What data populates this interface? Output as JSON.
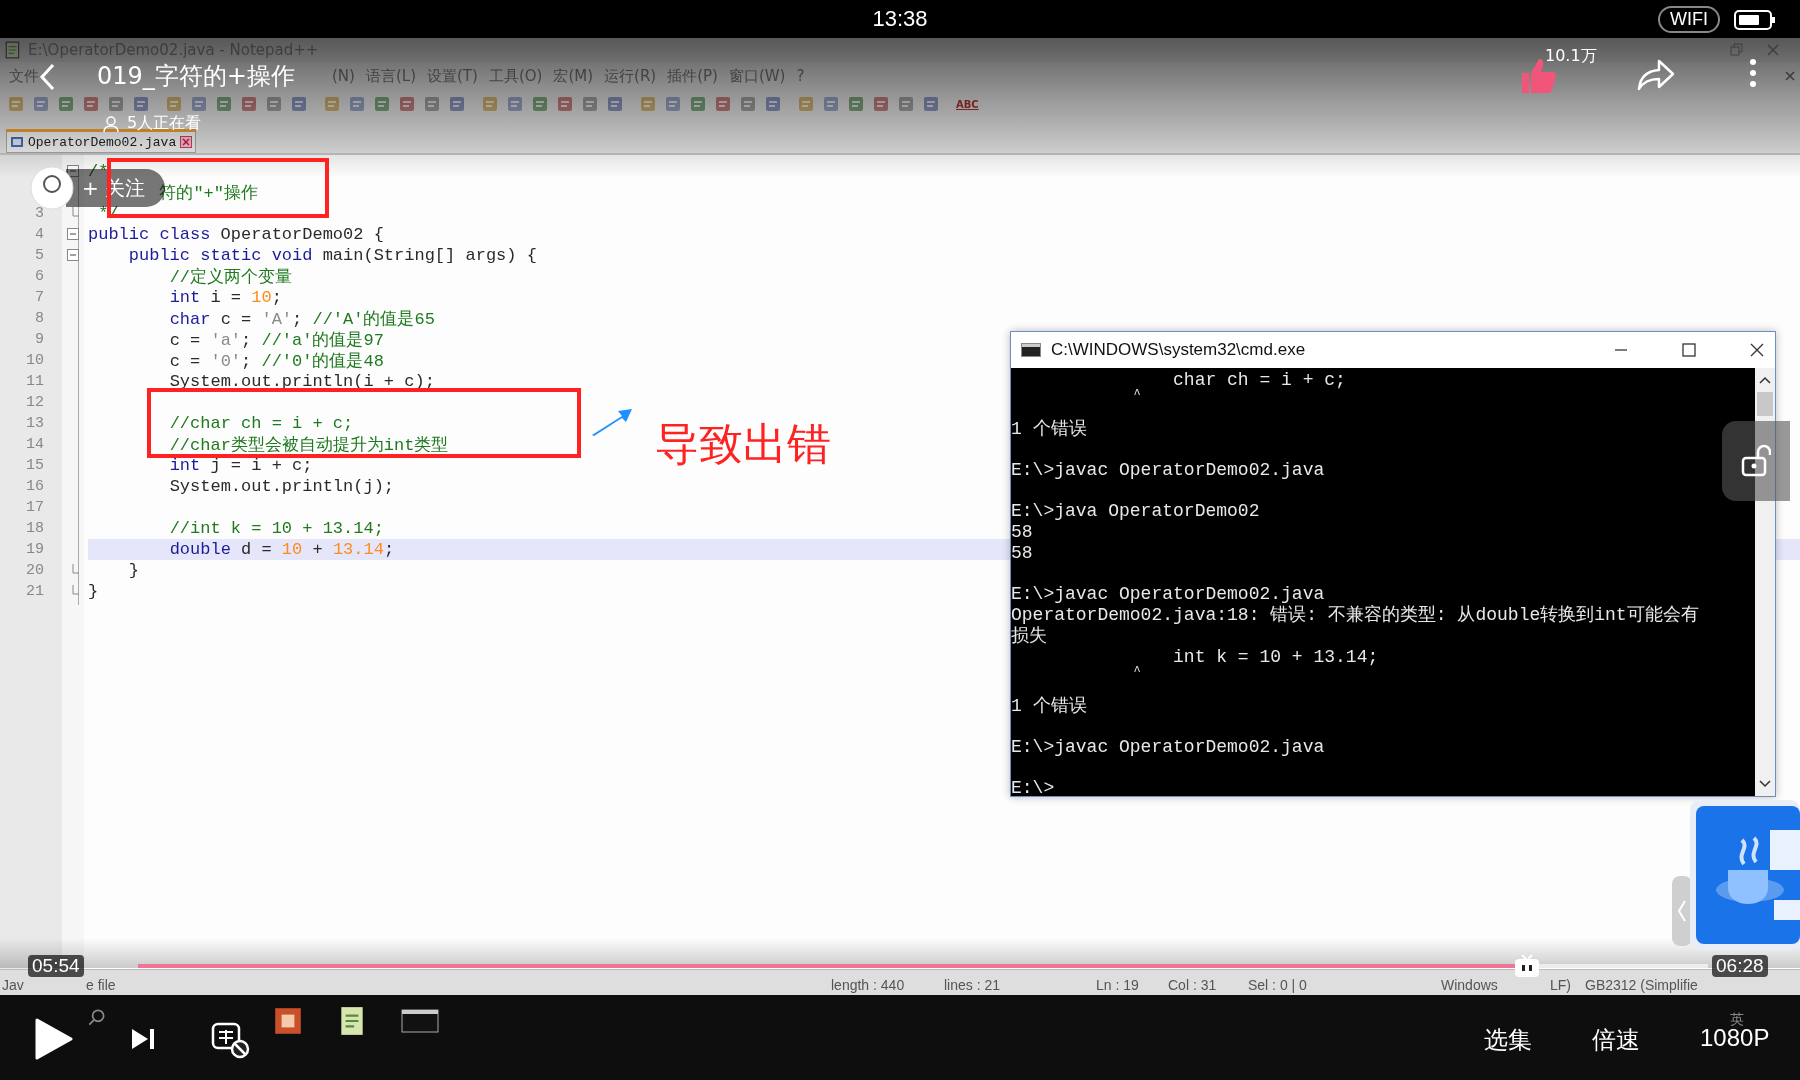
{
  "status_bar": {
    "time": "13:38",
    "wifi": "WIFI"
  },
  "video": {
    "title": "019_字符的+操作",
    "viewers": "5人正在看",
    "likes": "10.1万",
    "follow": "关注",
    "follow_plus": "+",
    "current_time": "05:54",
    "duration": "06:28",
    "level": 0.885,
    "episodes": "选集",
    "speed": "倍速",
    "quality": "1080P"
  },
  "notepad": {
    "title": "E:\\OperatorDemo02.java - Notepad++",
    "menu": [
      "文件",
      "(N)",
      "语言(L)",
      "设置(T)",
      "工具(O)",
      "宏(M)",
      "运行(R)",
      "插件(P)",
      "窗口(W)",
      "?"
    ],
    "spellcheck": "ABC",
    "tab": "OperatorDemo02.java",
    "lines": [
      {
        "fold_start": true,
        "fold_end": false,
        "current": false,
        "code": [
          {
            "kind": "comment",
            "text": "/*"
          }
        ]
      },
      {
        "fold_start": false,
        "fold_end": false,
        "current": false,
        "code": [
          {
            "kind": "comment",
            "text": "       符的\"+\"操作"
          }
        ]
      },
      {
        "number": "3",
        "fold_start": false,
        "fold_end": true,
        "current": false,
        "code": [
          {
            "kind": "comment",
            "text": " */"
          }
        ]
      },
      {
        "number": "4",
        "fold_start": true,
        "fold_end": false,
        "current": false,
        "code": [
          {
            "kind": "keyword",
            "text": "public class"
          },
          {
            "kind": "plain",
            "text": " OperatorDemo02 {"
          }
        ]
      },
      {
        "number": "5",
        "fold_start": true,
        "fold_end": false,
        "current": false,
        "code": [
          {
            "kind": "keyword",
            "text": "    public static void"
          },
          {
            "kind": "plain",
            "text": " main(String[] args) {"
          }
        ]
      },
      {
        "number": "6",
        "fold_start": false,
        "fold_end": false,
        "current": false,
        "code": [
          {
            "kind": "comment",
            "text": "        //定义两个变量"
          }
        ]
      },
      {
        "number": "7",
        "fold_start": false,
        "fold_end": false,
        "current": false,
        "code": [
          {
            "kind": "keyword",
            "text": "        int"
          },
          {
            "kind": "plain",
            "text": " i = "
          },
          {
            "kind": "number",
            "text": "10"
          },
          {
            "kind": "plain",
            "text": ";"
          }
        ]
      },
      {
        "number": "8",
        "fold_start": false,
        "fold_end": false,
        "current": false,
        "code": [
          {
            "kind": "keyword",
            "text": "        char"
          },
          {
            "kind": "plain",
            "text": " c = "
          },
          {
            "kind": "string",
            "text": "'A'"
          },
          {
            "kind": "plain",
            "text": "; "
          },
          {
            "kind": "comment",
            "text": "//'A'的值是65"
          }
        ]
      },
      {
        "number": "9",
        "fold_start": false,
        "fold_end": false,
        "current": false,
        "code": [
          {
            "kind": "plain",
            "text": "        c = "
          },
          {
            "kind": "string",
            "text": "'a'"
          },
          {
            "kind": "plain",
            "text": "; "
          },
          {
            "kind": "comment",
            "text": "//'a'的值是97"
          }
        ]
      },
      {
        "number": "10",
        "fold_start": false,
        "fold_end": false,
        "current": false,
        "code": [
          {
            "kind": "plain",
            "text": "        c = "
          },
          {
            "kind": "string",
            "text": "'0'"
          },
          {
            "kind": "plain",
            "text": "; "
          },
          {
            "kind": "comment",
            "text": "//'0'的值是48"
          }
        ]
      },
      {
        "number": "11",
        "fold_start": false,
        "fold_end": false,
        "current": false,
        "code": [
          {
            "kind": "plain",
            "text": "        System.out.println(i + c);"
          }
        ]
      },
      {
        "number": "12",
        "fold_start": false,
        "fold_end": false,
        "current": false
      },
      {
        "number": "13",
        "fold_start": false,
        "fold_end": false,
        "current": false,
        "code": [
          {
            "kind": "comment",
            "text": "        //char ch = i + c;"
          }
        ]
      },
      {
        "number": "14",
        "fold_start": false,
        "fold_end": false,
        "current": false,
        "code": [
          {
            "kind": "comment",
            "text": "        //char类型会被自动提升为int类型"
          }
        ]
      },
      {
        "number": "15",
        "fold_start": false,
        "fold_end": false,
        "current": false,
        "code": [
          {
            "kind": "keyword",
            "text": "        int"
          },
          {
            "kind": "plain",
            "text": " j = i + c;"
          }
        ]
      },
      {
        "number": "16",
        "fold_start": false,
        "fold_end": false,
        "current": false,
        "code": [
          {
            "kind": "plain",
            "text": "        System.out.println(j);"
          }
        ]
      },
      {
        "number": "17",
        "fold_start": false,
        "fold_end": false,
        "current": false
      },
      {
        "number": "18",
        "fold_start": false,
        "fold_end": false,
        "current": false,
        "code": [
          {
            "kind": "comment",
            "text": "        //int k = 10 + 13.14;"
          }
        ]
      },
      {
        "number": "19",
        "fold_start": false,
        "fold_end": false,
        "current": true,
        "code": [
          {
            "kind": "keyword",
            "text": "        double"
          },
          {
            "kind": "plain",
            "text": " d = "
          },
          {
            "kind": "number",
            "text": "10"
          },
          {
            "kind": "plain",
            "text": " + "
          },
          {
            "kind": "number",
            "text": "13.14"
          },
          {
            "kind": "plain",
            "text": ";"
          }
        ]
      },
      {
        "number": "20",
        "fold_start": false,
        "fold_end": true,
        "current": false,
        "code": [
          {
            "kind": "plain",
            "text": "    }"
          }
        ]
      },
      {
        "number": "21",
        "fold_start": false,
        "fold_end": true,
        "current": false,
        "code": [
          {
            "kind": "plain",
            "text": "}"
          }
        ]
      }
    ],
    "status": [
      {
        "text": "Jav"
      },
      {
        "text": "e file"
      },
      {
        "text": "length : 440"
      },
      {
        "text": "lines : 21"
      },
      {
        "text": "Ln : 19"
      },
      {
        "text": "Col : 31"
      },
      {
        "text": "Sel : 0 | 0"
      },
      {
        "text": "Windows"
      },
      {
        "text": "LF)"
      },
      {
        "text": "GB2312 (Simplifie"
      }
    ]
  },
  "annotation": {
    "text": "导致出错"
  },
  "cmd": {
    "title": "C:\\WINDOWS\\system32\\cmd.exe",
    "blocks": [
      [
        {
          "kind": "text",
          "text": "               char ch = i + c;"
        },
        {
          "kind": "caret",
          "text": "                 ^"
        }
      ],
      [
        {
          "kind": "text",
          "text": "1 个错误"
        }
      ],
      [
        {
          "kind": "text",
          "text": "E:\\>javac OperatorDemo02.java"
        }
      ],
      [
        {
          "kind": "text",
          "text": "E:\\>java OperatorDemo02"
        },
        {
          "kind": "text",
          "text": "58"
        },
        {
          "kind": "text",
          "text": "58"
        }
      ],
      [
        {
          "kind": "text",
          "text": "E:\\>javac OperatorDemo02.java"
        },
        {
          "kind": "text",
          "text": "OperatorDemo02.java:18: 错误: 不兼容的类型: 从double转换到int可能会有"
        },
        {
          "kind": "text",
          "text": "损失"
        },
        {
          "kind": "text",
          "text": "               int k = 10 + 13.14;"
        },
        {
          "kind": "caret",
          "text": "                 ^"
        }
      ],
      [
        {
          "kind": "text",
          "text": "1 个错误"
        }
      ],
      [
        {
          "kind": "text",
          "text": "E:\\>javac OperatorDemo02.java"
        }
      ],
      [
        {
          "kind": "text",
          "text": "E:\\>"
        }
      ]
    ]
  },
  "tray": {
    "ime": "英"
  }
}
